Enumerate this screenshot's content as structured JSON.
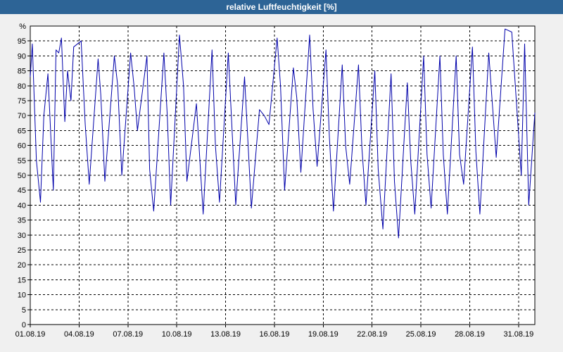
{
  "window": {
    "title": "relative Luftfeuchtigkeit [%]",
    "title_bg": "#2d6496"
  },
  "chart_data": {
    "type": "line",
    "title": "relative Luftfeuchtigkeit [%]",
    "ylabel": "%",
    "xlabel": "",
    "ylim": [
      0,
      100
    ],
    "yticks": [
      0,
      5,
      10,
      15,
      20,
      25,
      30,
      35,
      40,
      45,
      50,
      55,
      60,
      65,
      70,
      75,
      80,
      85,
      90,
      95
    ],
    "xlim": [
      "2019-08-01",
      "2019-09-01"
    ],
    "xtick_labels": [
      "01.08.19",
      "04.08.19",
      "07.08.19",
      "10.08.19",
      "13.08.19",
      "16.08.19",
      "19.08.19",
      "22.08.19",
      "25.08.19",
      "28.08.19",
      "31.08.19"
    ],
    "grid": true,
    "line_color": "#0000aa",
    "series": [
      {
        "x": [
          "2019-08-01T00:00",
          "2019-08-01T03:00",
          "2019-08-01T09:00",
          "2019-08-01T15:00",
          "2019-08-01T20:00",
          "2019-08-02T02:00",
          "2019-08-02T10:00",
          "2019-08-02T14:00",
          "2019-08-02T18:00",
          "2019-08-02T22:00",
          "2019-08-03T03:00",
          "2019-08-03T07:00",
          "2019-08-03T12:00",
          "2019-08-03T16:00",
          "2019-08-04T03:00",
          "2019-08-04T09:00",
          "2019-08-04T15:00",
          "2019-08-05T04:00",
          "2019-08-05T08:00",
          "2019-08-05T14:00",
          "2019-08-06T04:00",
          "2019-08-06T09:00",
          "2019-08-06T15:00",
          "2019-08-07T04:00",
          "2019-08-07T09:00",
          "2019-08-07T14:00",
          "2019-08-08T04:00",
          "2019-08-08T08:00",
          "2019-08-08T14:00",
          "2019-08-09T05:00",
          "2019-08-09T10:00",
          "2019-08-09T15:00",
          "2019-08-10T04:00",
          "2019-08-10T10:00",
          "2019-08-10T15:00",
          "2019-08-11T05:00",
          "2019-08-11T15:00",
          "2019-08-12T04:00",
          "2019-08-12T09:00",
          "2019-08-12T15:00",
          "2019-08-13T04:00",
          "2019-08-13T10:00",
          "2019-08-13T15:00",
          "2019-08-14T04:00",
          "2019-08-14T14:00",
          "2019-08-15T02:00",
          "2019-08-15T09:00",
          "2019-08-15T16:00",
          "2019-08-16T04:00",
          "2019-08-16T09:00",
          "2019-08-16T15:00",
          "2019-08-17T04:00",
          "2019-08-17T09:00",
          "2019-08-17T15:00",
          "2019-08-18T04:00",
          "2019-08-18T09:00",
          "2019-08-18T15:00",
          "2019-08-19T04:00",
          "2019-08-19T09:00",
          "2019-08-19T15:00",
          "2019-08-20T04:00",
          "2019-08-20T09:00",
          "2019-08-20T15:00",
          "2019-08-21T04:00",
          "2019-08-21T09:00",
          "2019-08-21T15:00",
          "2019-08-22T04:00",
          "2019-08-22T09:00",
          "2019-08-22T16:00",
          "2019-08-23T04:00",
          "2019-08-23T09:00",
          "2019-08-23T15:00",
          "2019-08-24T04:00",
          "2019-08-24T09:00",
          "2019-08-24T15:00",
          "2019-08-25T04:00",
          "2019-08-25T09:00",
          "2019-08-25T15:00",
          "2019-08-26T04:00",
          "2019-08-26T09:00",
          "2019-08-26T15:00",
          "2019-08-27T04:00",
          "2019-08-27T09:00",
          "2019-08-27T15:00",
          "2019-08-28T04:00",
          "2019-08-28T09:00",
          "2019-08-28T15:00",
          "2019-08-29T04:00",
          "2019-08-29T09:00",
          "2019-08-29T15:00",
          "2019-08-30T04:00",
          "2019-08-30T14:00",
          "2019-08-31T04:00",
          "2019-08-31T09:00",
          "2019-08-31T15:00",
          "2019-09-01T00:00"
        ],
        "y": [
          83,
          94,
          55,
          41,
          70,
          84,
          45,
          92,
          91,
          96,
          68,
          85,
          75,
          93,
          95,
          67,
          47,
          89,
          77,
          48,
          90,
          80,
          50,
          91,
          80,
          65,
          90,
          52,
          38,
          91,
          70,
          40,
          97,
          80,
          48,
          74,
          37,
          92,
          60,
          41,
          91,
          63,
          40,
          83,
          39,
          72,
          70,
          67,
          96,
          80,
          45,
          86,
          76,
          51,
          97,
          72,
          53,
          92,
          63,
          38,
          87,
          60,
          47,
          87,
          59,
          40,
          85,
          52,
          32,
          84,
          48,
          29,
          81,
          55,
          37,
          90,
          57,
          39,
          90,
          57,
          37,
          90,
          57,
          47,
          93,
          58,
          37,
          91,
          75,
          56,
          99,
          98,
          50,
          94,
          40,
          71
        ]
      }
    ]
  }
}
